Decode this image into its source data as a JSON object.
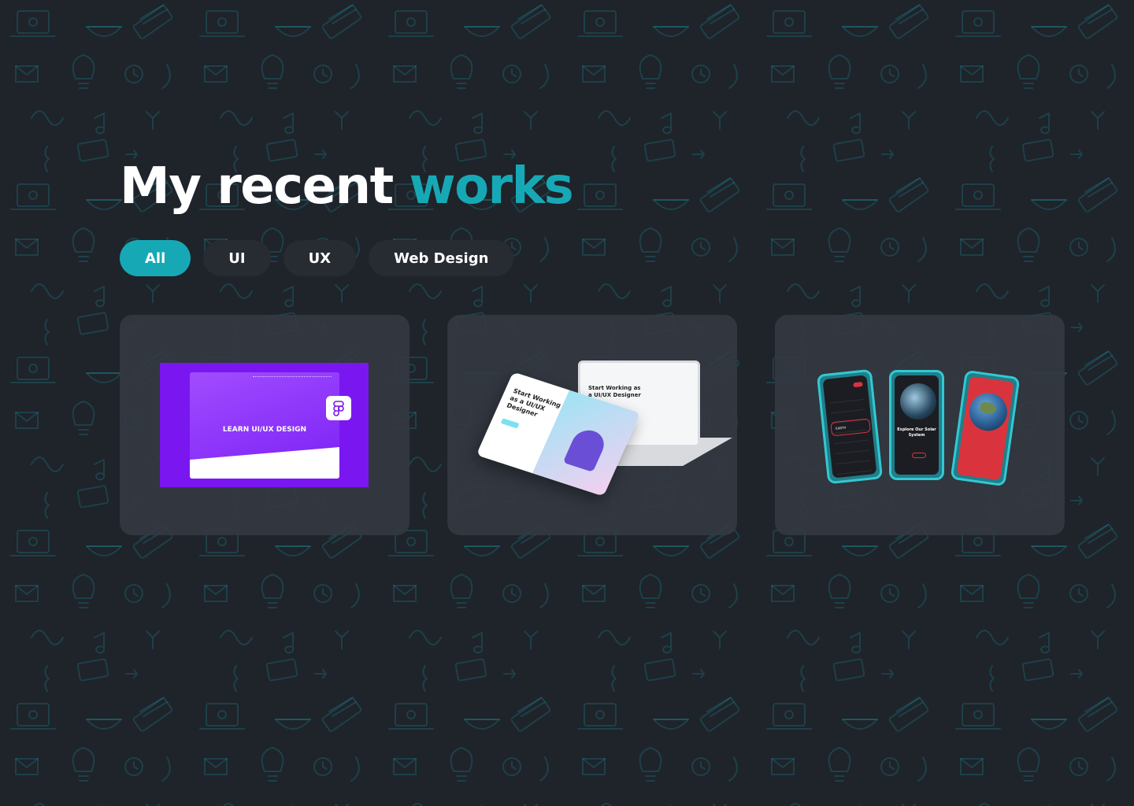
{
  "colors": {
    "background": "#1f232a",
    "accent": "#16a9b5",
    "doodle": "#16a9b5"
  },
  "header": {
    "title_plain": "My recent",
    "title_accent": "works"
  },
  "filters": [
    {
      "label": "All",
      "active": true
    },
    {
      "label": "UI",
      "active": false
    },
    {
      "label": "UX",
      "active": false
    },
    {
      "label": "Web Design",
      "active": false
    }
  ],
  "projects": [
    {
      "mock_heading": "LEARN UI/UX DESIGN",
      "icon": "figma-icon"
    },
    {
      "mock_heading": "Start Working as a UI/UX Designer"
    },
    {
      "mock_heading": "Explore Our Solar System",
      "selected_item": "EARTH"
    }
  ]
}
